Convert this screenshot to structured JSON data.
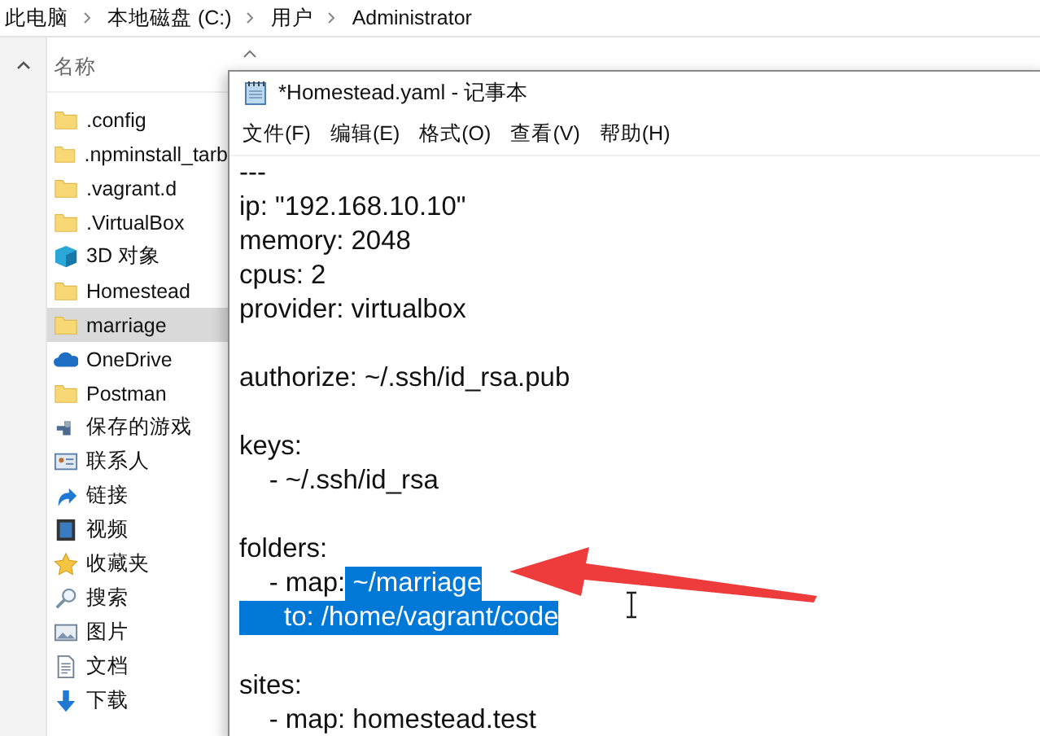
{
  "breadcrumb": [
    "此电脑",
    "本地磁盘 (C:)",
    "用户",
    "Administrator"
  ],
  "explorer": {
    "column_header": "名称",
    "nav_items": [
      {
        "label": ".config",
        "kind": "folder",
        "selected": false
      },
      {
        "label": ".npminstall_tarb",
        "kind": "folder",
        "selected": false
      },
      {
        "label": ".vagrant.d",
        "kind": "folder",
        "selected": false
      },
      {
        "label": ".VirtualBox",
        "kind": "folder",
        "selected": false
      },
      {
        "label": "3D 对象",
        "kind": "cube",
        "selected": false
      },
      {
        "label": "Homestead",
        "kind": "folder",
        "selected": false
      },
      {
        "label": "marriage",
        "kind": "folder",
        "selected": true
      },
      {
        "label": "OneDrive",
        "kind": "cloud",
        "selected": false
      },
      {
        "label": "Postman",
        "kind": "folder",
        "selected": false
      },
      {
        "label": "保存的游戏",
        "kind": "game",
        "selected": false
      },
      {
        "label": "联系人",
        "kind": "contacts",
        "selected": false
      },
      {
        "label": "链接",
        "kind": "link",
        "selected": false
      },
      {
        "label": "视频",
        "kind": "video",
        "selected": false
      },
      {
        "label": "收藏夹",
        "kind": "star",
        "selected": false
      },
      {
        "label": "搜索",
        "kind": "search",
        "selected": false
      },
      {
        "label": "图片",
        "kind": "picture",
        "selected": false
      },
      {
        "label": "文档",
        "kind": "document",
        "selected": false
      },
      {
        "label": "下载",
        "kind": "download",
        "selected": false
      }
    ]
  },
  "notepad": {
    "title": "*Homestead.yaml - 记事本",
    "menu": [
      "文件(F)",
      "编辑(E)",
      "格式(O)",
      "查看(V)",
      "帮助(H)"
    ],
    "blocks": [
      {
        "lines": [
          [
            {
              "text": "---",
              "selected": false
            }
          ],
          [
            {
              "text": "ip: \"192.168.10.10\"",
              "selected": false
            }
          ],
          [
            {
              "text": "memory: 2048",
              "selected": false
            }
          ],
          [
            {
              "text": "cpus: 2",
              "selected": false
            }
          ],
          [
            {
              "text": "provider: virtualbox",
              "selected": false
            }
          ]
        ]
      },
      {
        "lines": [
          [
            {
              "text": "authorize: ~/.ssh/id_rsa.pub",
              "selected": false
            }
          ]
        ]
      },
      {
        "lines": [
          [
            {
              "text": "keys:",
              "selected": false
            }
          ],
          [
            {
              "text": "    - ~/.ssh/id_rsa",
              "selected": false
            }
          ]
        ]
      },
      {
        "lines": [
          [
            {
              "text": "folders:",
              "selected": false
            }
          ],
          [
            {
              "text": "    - map:",
              "selected": false
            },
            {
              "text": " ~/marriage",
              "selected": true
            }
          ],
          [
            {
              "text": "      to: /home/vagrant/code",
              "selected": true
            }
          ]
        ]
      },
      {
        "lines": [
          [
            {
              "text": "sites:",
              "selected": false
            }
          ],
          [
            {
              "text": "    - map: homestead.test",
              "selected": false
            }
          ]
        ]
      }
    ]
  }
}
